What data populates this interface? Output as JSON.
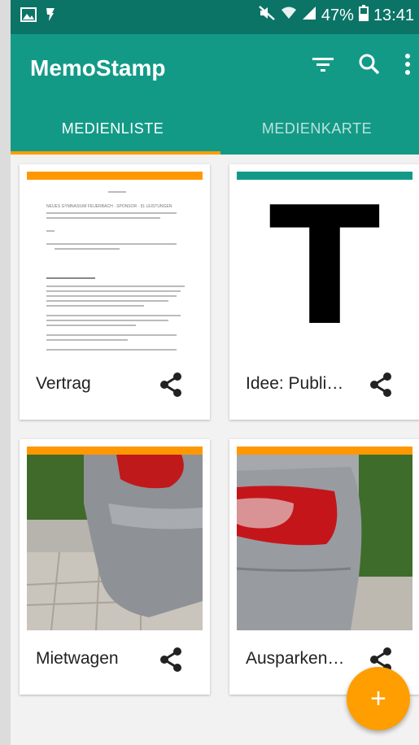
{
  "status_bar": {
    "battery": "47%",
    "time": "13:41"
  },
  "app_bar": {
    "title": "MemoStamp"
  },
  "tabs": [
    {
      "label": "MEDIENLISTE",
      "active": true
    },
    {
      "label": "MEDIENKARTE",
      "active": false
    }
  ],
  "cards": [
    {
      "title": "Vertrag",
      "accent_color": "#ff9800",
      "thumbnail": "document-scan",
      "doc_header": "NEUES GYMNASIUM FEUERBACH · SPONSOR · §1 LEISTUNGEN"
    },
    {
      "title": "Idee: Publi…",
      "accent_color": "#139a87",
      "thumbnail": "letter-T",
      "thumb_letter": "T"
    },
    {
      "title": "Mietwagen",
      "accent_color": "#ff9800",
      "thumbnail": "car-photo"
    },
    {
      "title": "Ausparken…",
      "accent_color": "#ff9800",
      "thumbnail": "car-photo"
    }
  ],
  "fab": {
    "icon": "plus-icon",
    "glyph": "+"
  },
  "colors": {
    "primary": "#139a87",
    "primary_dark": "#0b7466",
    "accent": "#ff9e00"
  }
}
